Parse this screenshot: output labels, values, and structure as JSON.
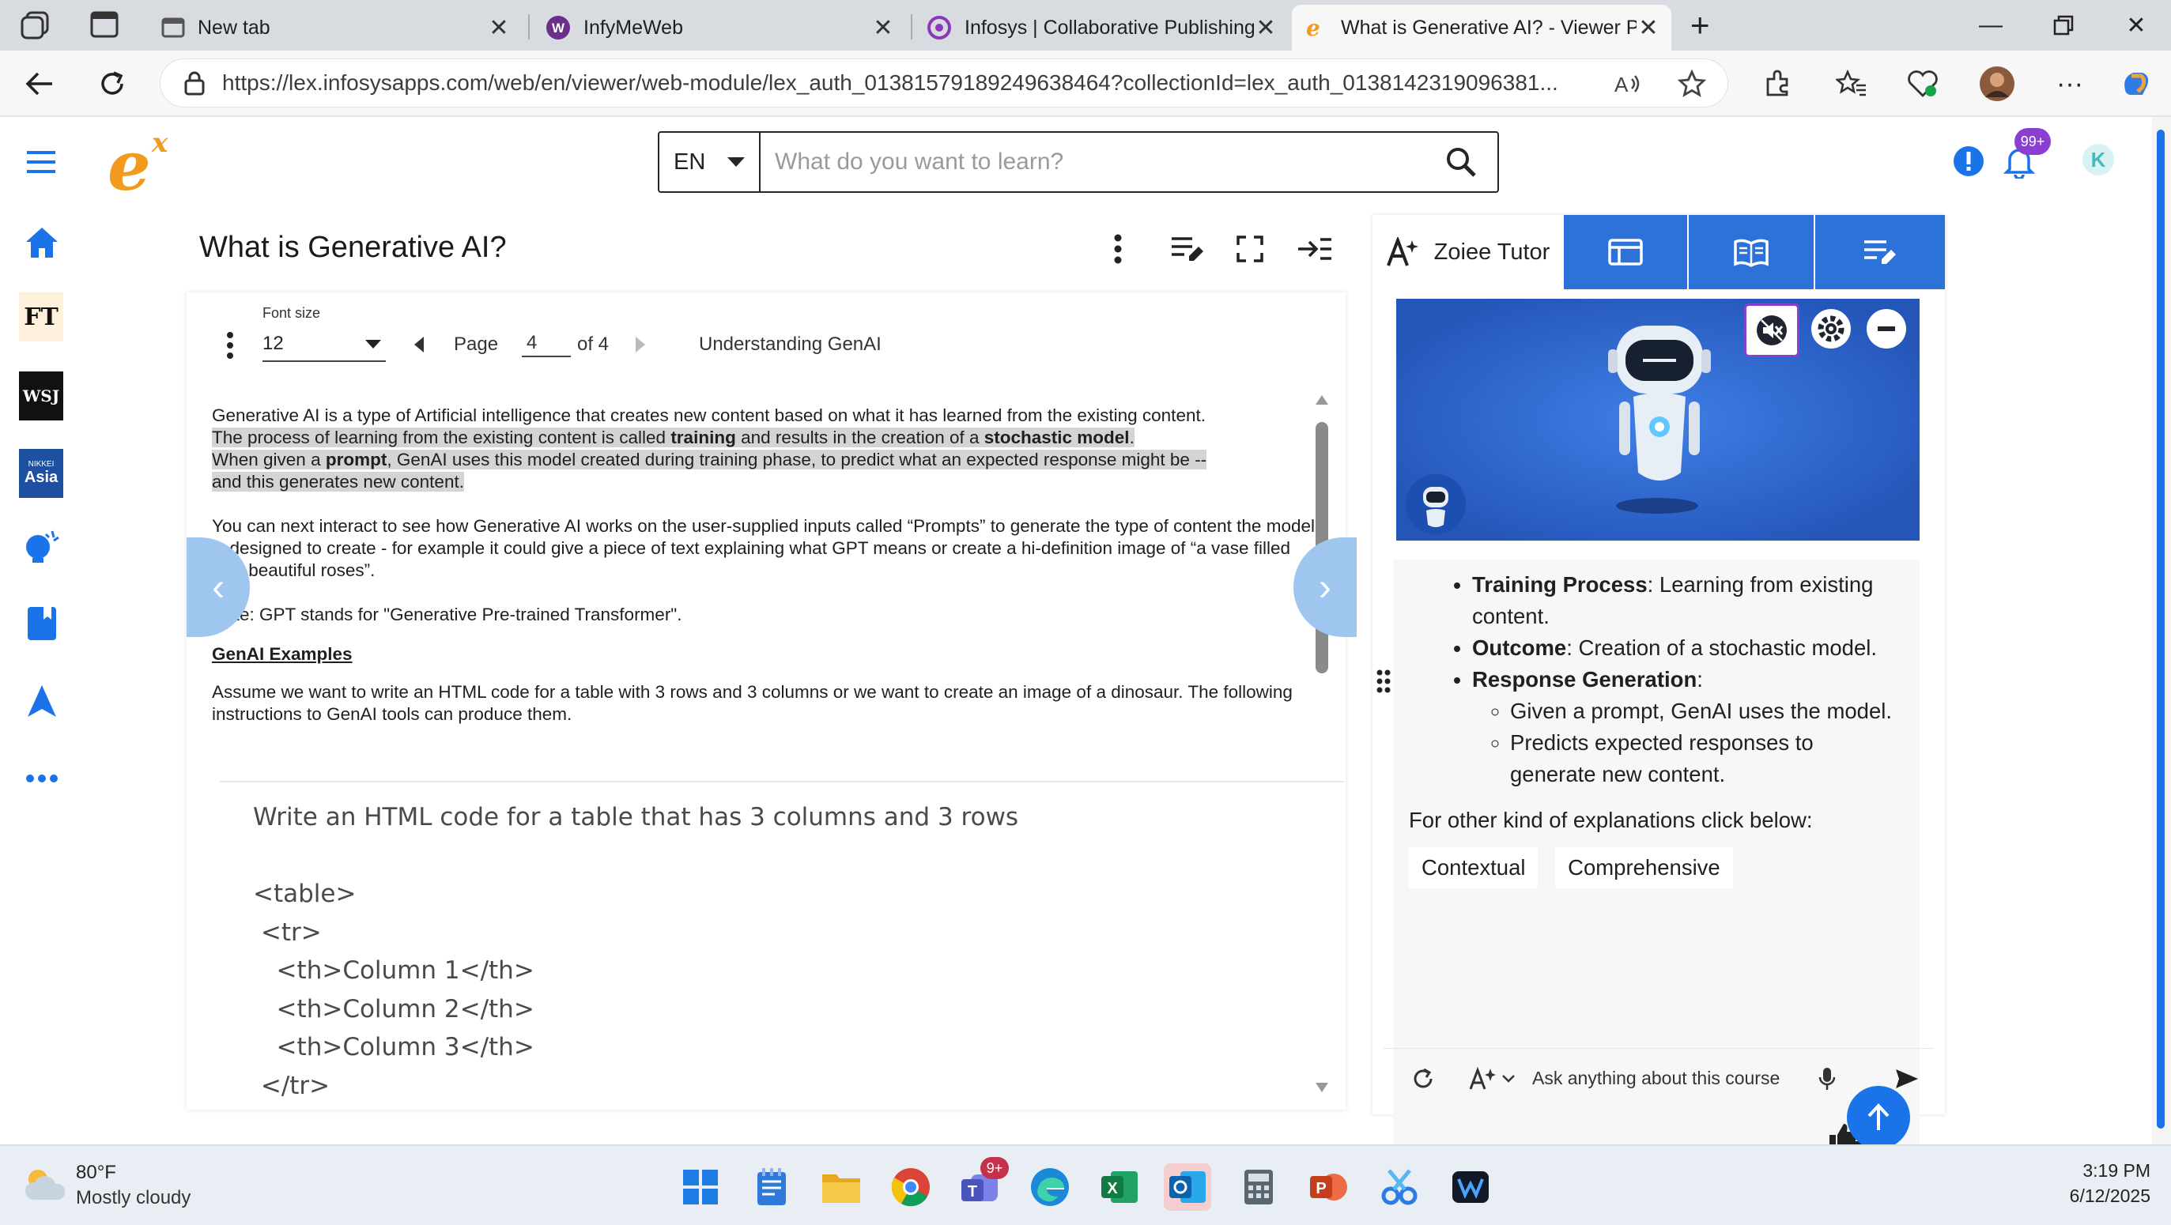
{
  "browser": {
    "tabs": [
      {
        "title": "New tab",
        "icon": "new-tab-icon"
      },
      {
        "title": "InfyMeWeb",
        "icon": "infymeweb-icon"
      },
      {
        "title": "Infosys | Collaborative Publishing",
        "icon": "publishing-icon"
      },
      {
        "title": "What is Generative AI? - Viewer P",
        "icon": "lex-icon",
        "active": true
      }
    ],
    "url": "https://lex.infosysapps.com/web/en/viewer/web-module/lex_auth_01381579189249638464?collectionId=lex_auth_0138142319096381..."
  },
  "header": {
    "language": "EN",
    "search_placeholder": "What do you want to learn?",
    "notification_count": "99+"
  },
  "rail": {
    "items": [
      "home-icon",
      "ft-icon",
      "wsj-icon",
      "nikkei-asia-icon",
      "ideas-icon",
      "book-icon",
      "navigate-icon",
      "more-icon"
    ],
    "ft_label": "FT",
    "wsj_label": "WSJ",
    "nikkei_top": "NIKKEI",
    "nikkei_bottom": "Asia"
  },
  "content": {
    "title": "What is Generative AI?",
    "font_size_label": "Font size",
    "font_size_value": "12",
    "page_label": "Page",
    "page_value": "4",
    "page_of": "of 4",
    "section_title": "Understanding GenAI",
    "para1_line1": "Generative AI is a type of Artificial intelligence that creates new content based on what it has learned from the existing content.",
    "para1_line2a": "The process of learning from the existing content is called ",
    "para1_line2b": "training",
    "para1_line2c": " and results in the creation of a ",
    "para1_line2d": "stochastic model",
    "para1_line2e": ".",
    "para1_line3a": "When given a ",
    "para1_line3b": "prompt",
    "para1_line3c": ", GenAI uses this model created during training phase,  to predict what an expected response might be --",
    "para1_line4": "and this generates new content.",
    "para2": "You can next interact to see how Generative AI works on the user-supplied inputs called “Prompts” to generate the type of content the model is designed to create - for example it could give a piece of text explaining what GPT means or create a hi-definition image of “a vase filled with beautiful roses”.",
    "note": "Note: GPT stands for \"Generative Pre-trained Transformer\".",
    "examples_heading": "GenAI Examples",
    "para3": "Assume we want to write an HTML code for a table with 3 rows and 3 columns or we want to create an image of a dinosaur. The following instructions to GenAI tools can produce them.",
    "code_lines": [
      "Write an HTML code for a table that has 3 columns and 3 rows",
      "",
      "<table>",
      " <tr>",
      "   <th>Column 1</th>",
      "   <th>Column 2</th>",
      "   <th>Column 3</th>",
      " </tr>"
    ]
  },
  "tutor": {
    "tab_label": "Zoiee Tutor",
    "bullets": [
      {
        "bold": "Training Process",
        "text": ": Learning from existing content."
      },
      {
        "bold": "Outcome",
        "text": ": Creation of a stochastic model."
      },
      {
        "bold": "Response Generation",
        "text": ":"
      }
    ],
    "sub_bullets": [
      "Given a prompt, GenAI uses the model.",
      "Predicts expected responses to generate new content."
    ],
    "other_kind": "For other kind of explanations click below:",
    "chip_contextual": "Contextual",
    "chip_comprehensive": "Comprehensive",
    "input_placeholder": "Ask anything about this course"
  },
  "taskbar": {
    "weather_temp": "80°F",
    "weather_desc": "Mostly cloudy",
    "time": "3:19 PM",
    "date": "6/12/2025",
    "teams_badge": "9+"
  },
  "colors": {
    "accent_blue": "#1a73e8",
    "tutor_tab_blue": "#2c72d9",
    "robot_bg": "#2c65cf",
    "logo_orange": "#f29a1d"
  }
}
